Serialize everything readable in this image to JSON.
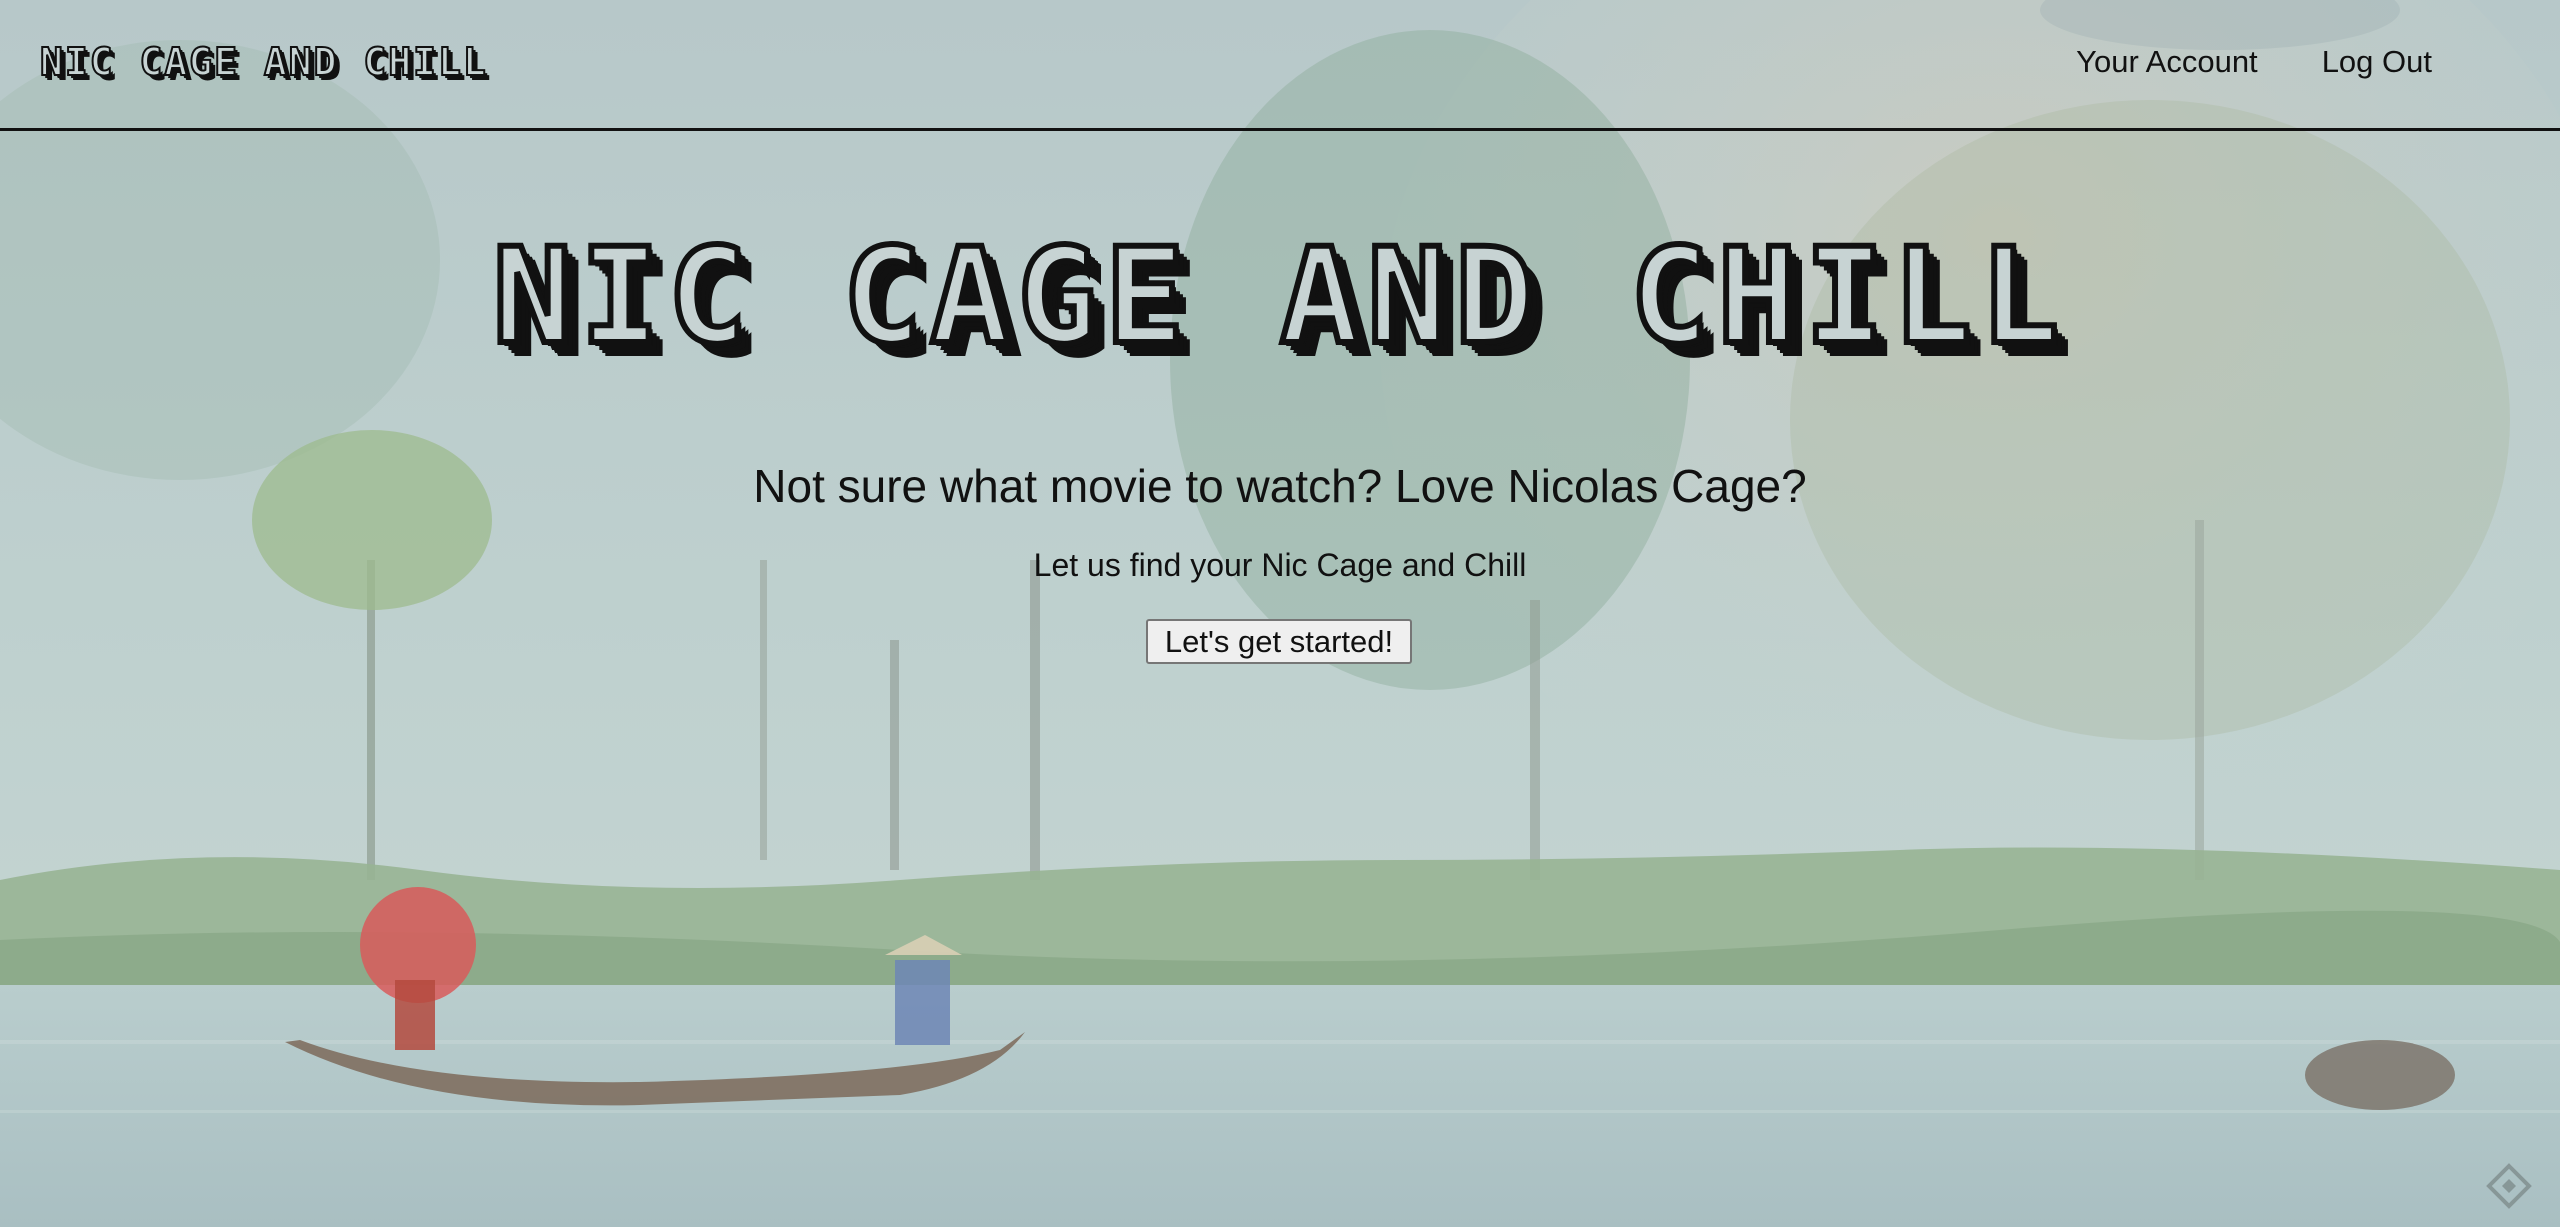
{
  "header": {
    "brand": "NIC CAGE AND CHILL",
    "nav": {
      "account": "Your Account",
      "logout": "Log Out"
    }
  },
  "hero": {
    "title": "NIC CAGE AND CHILL",
    "question": "Not sure what movie to watch? Love Nicolas Cage?",
    "subtitle": "Let us find your Nic Cage and Chill",
    "cta": "Let's get started!"
  },
  "colors": {
    "background_wash": "#bcd0d2",
    "text": "#111111",
    "title_fill": "#c7d3d3",
    "button_bg": "#efefef"
  },
  "icons": {
    "corner": "diamond-logo-icon"
  }
}
